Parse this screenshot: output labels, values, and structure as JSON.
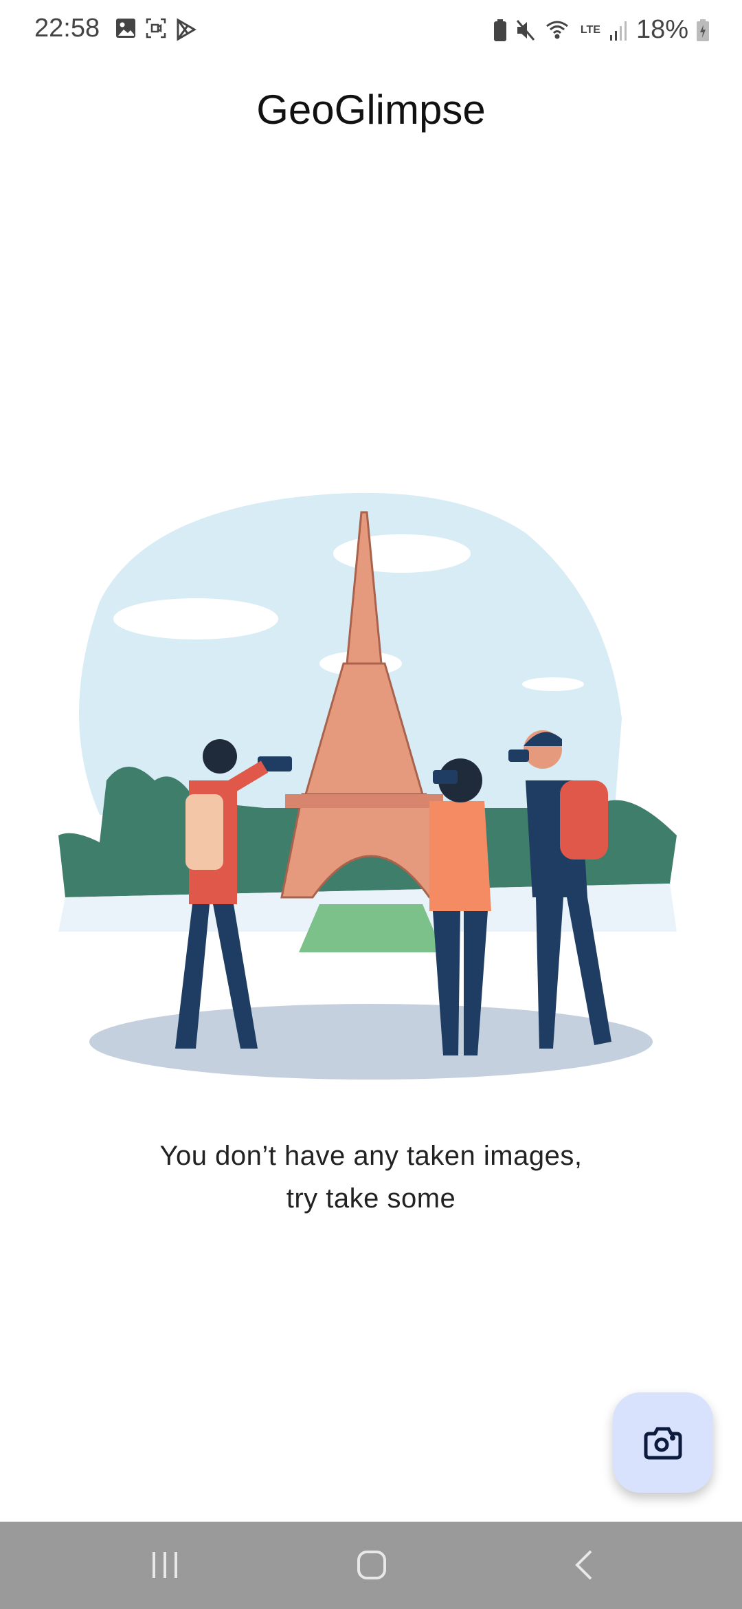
{
  "status_bar": {
    "time": "22:58",
    "battery": "18%",
    "network": "LTE"
  },
  "app_bar": {
    "title": "GeoGlimpse"
  },
  "empty_state": {
    "line1": "You don’t have any taken images,",
    "line2": "try take some"
  },
  "fab": {
    "icon": "camera-icon"
  },
  "colors": {
    "fab_bg": "#d8e2fc",
    "fab_icon": "#0d1b3e",
    "nav_bg": "#9a9a9a"
  }
}
